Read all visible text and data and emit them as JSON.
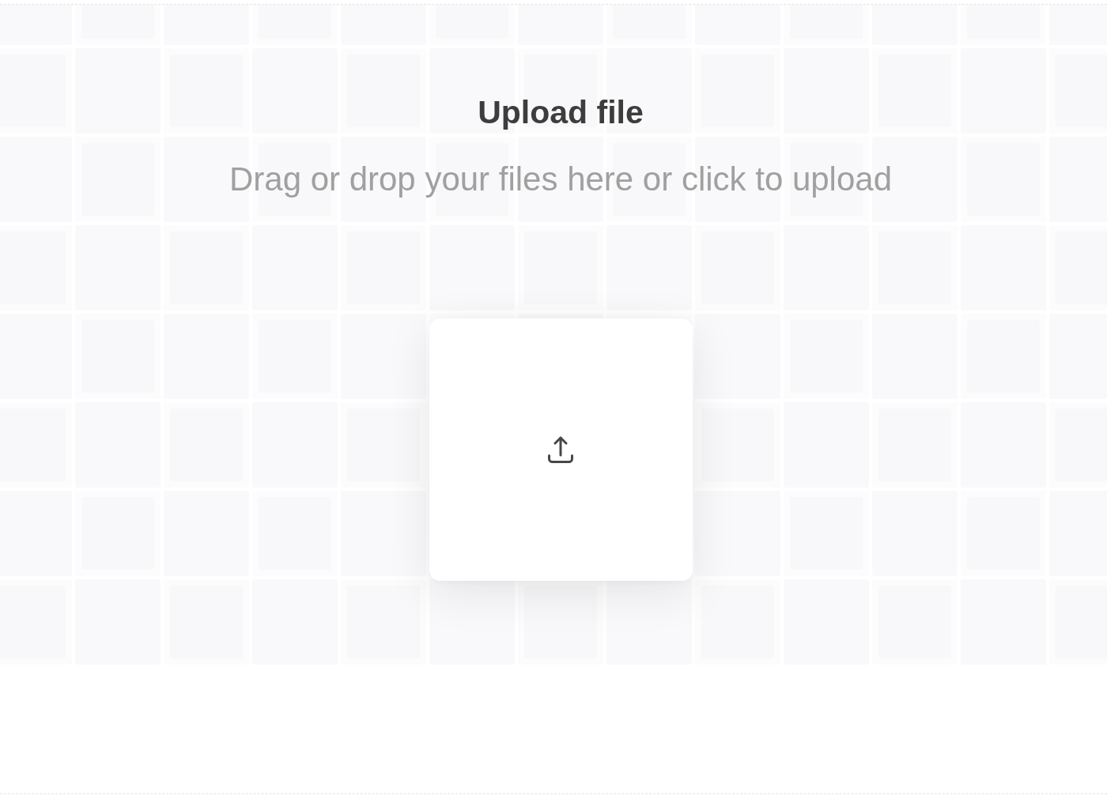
{
  "upload": {
    "title": "Upload file",
    "hint": "Drag or drop your files here or click to upload"
  }
}
